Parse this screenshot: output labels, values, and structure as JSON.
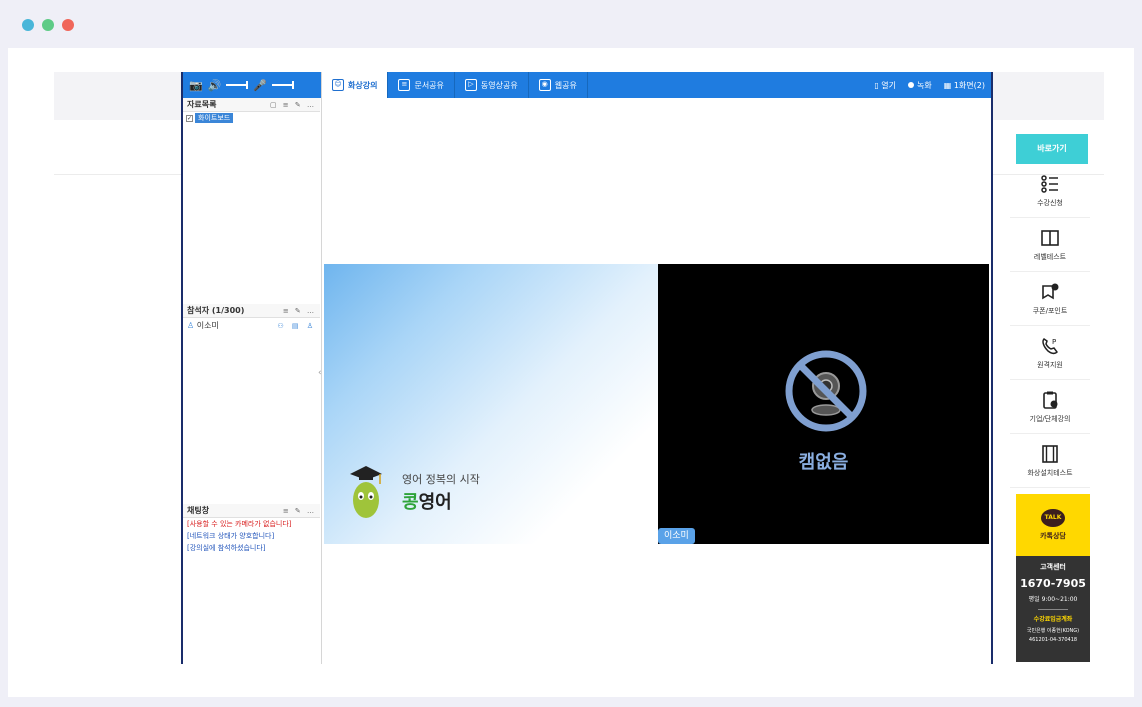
{
  "window": {
    "controls": [
      "close",
      "minimize",
      "maximize"
    ]
  },
  "left_panel": {
    "materials": {
      "title": "자료목록",
      "tools": "▢ ≡ ✎ …",
      "items": [
        {
          "label": "화이트보드",
          "checked": true
        }
      ]
    },
    "participants": {
      "title": "참석자 (1/300)",
      "tools": "≡ ✎ …",
      "list": [
        {
          "name": "이소미",
          "icons": "⚇ ▤ ♙"
        }
      ]
    },
    "chat": {
      "title": "채팅창",
      "tools": "≡ ✎ …",
      "messages": [
        {
          "text": "[사용할 수 있는 카메라가 없습니다]",
          "color": "red"
        },
        {
          "text": "[네트워크 상태가 양호합니다]",
          "color": "blue"
        },
        {
          "text": "[강의실에 참석하셨습니다]",
          "color": "blue"
        }
      ]
    }
  },
  "tabs": [
    {
      "label": "화상강의",
      "icon": "person-icon",
      "active": true
    },
    {
      "label": "문서공유",
      "icon": "document-icon",
      "active": false
    },
    {
      "label": "동영상공유",
      "icon": "play-icon",
      "active": false
    },
    {
      "label": "웹공유",
      "icon": "web-icon",
      "active": false
    }
  ],
  "toolbar_right": {
    "exit_label": "열기",
    "record_label": "녹화",
    "screen_label": "1화면(2)"
  },
  "video": {
    "logo_sub": "영어 정복의 시작",
    "logo_main_green": "콩",
    "logo_main_rest": "영어",
    "nocam_label": "캠없음",
    "name_tag": "이소미"
  },
  "quick_menu": {
    "header": "바로가기",
    "items": [
      {
        "label": "수강신청",
        "icon": "list-icon"
      },
      {
        "label": "레벨테스트",
        "icon": "book-icon"
      },
      {
        "label": "쿠폰/포인트",
        "icon": "coupon-icon"
      },
      {
        "label": "원격지원",
        "icon": "phone-icon"
      },
      {
        "label": "기업/단체강의",
        "icon": "clipboard-icon"
      },
      {
        "label": "화상설치테스트",
        "icon": "film-icon"
      }
    ],
    "kakao_badge": "TALK",
    "kakao_label": "카톡상담",
    "cs_title": "고객센터",
    "cs_phone": "1670-7905",
    "cs_hours": "평일 9:00~21:00",
    "cs_account_title": "수강료입금계좌",
    "cs_bank": "국민은행 이종헌(KONG)",
    "cs_account_no": "461201-04-370418"
  },
  "colors": {
    "toolbar_blue": "#1f7ce0",
    "quick_header": "#3ecfd6",
    "kakao_yellow": "#ffd800",
    "nocam_text": "#8aaee0"
  }
}
